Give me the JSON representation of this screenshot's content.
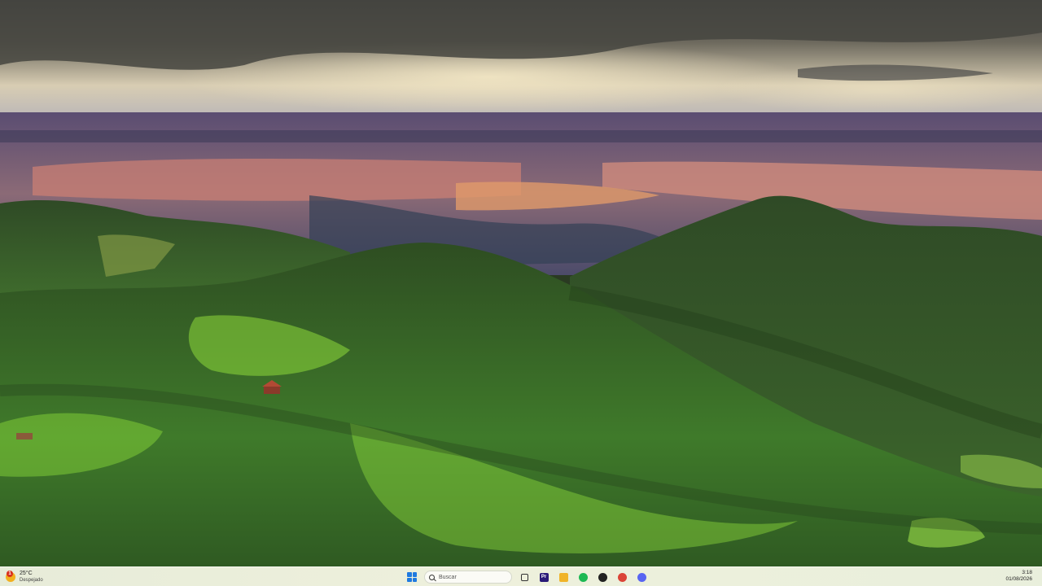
{
  "weather": {
    "temperature": "25°C",
    "condition": "Despejado",
    "alert_badge": "1"
  },
  "search": {
    "placeholder": "Buscar"
  },
  "taskbar_apps": [
    {
      "name": "task-view-icon",
      "glyph": ""
    },
    {
      "name": "premiere-pro-icon",
      "glyph": "Pr",
      "color": "#2a1a78"
    },
    {
      "name": "file-explorer-icon",
      "glyph": "",
      "color": "#f0b429"
    },
    {
      "name": "spotify-icon",
      "glyph": "",
      "color": "#1db954"
    },
    {
      "name": "app-icon",
      "glyph": "",
      "color": "#222222"
    },
    {
      "name": "chrome-icon",
      "glyph": "",
      "color": "#db4437"
    },
    {
      "name": "discord-icon",
      "glyph": "",
      "color": "#5865f2"
    }
  ],
  "clock": {
    "time": "3:18",
    "date": "01/08/2026"
  },
  "colors": {
    "accent": "#1f7ae0",
    "taskbar": "#e9eedb"
  }
}
